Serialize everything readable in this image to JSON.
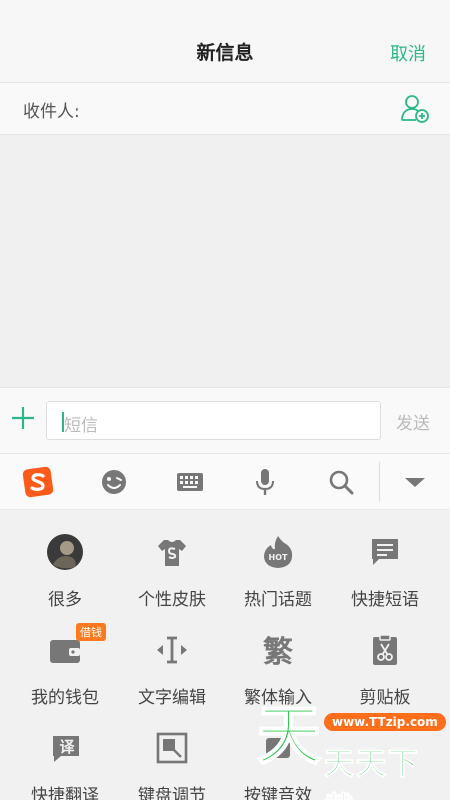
{
  "header": {
    "title": "新信息",
    "cancel_label": "取消"
  },
  "recipient": {
    "label": "收件人:"
  },
  "compose": {
    "placeholder": "短信",
    "send_label": "发送"
  },
  "ime_toolbar": {
    "icons": [
      "sogou-logo-icon",
      "emoji-icon",
      "keyboard-icon",
      "microphone-icon",
      "search-icon",
      "collapse-icon"
    ]
  },
  "panel": {
    "items": [
      {
        "label": "很多",
        "icon": "avatar-icon"
      },
      {
        "label": "个性皮肤",
        "icon": "tshirt-icon"
      },
      {
        "label": "热门话题",
        "icon": "hot-icon"
      },
      {
        "label": "快捷短语",
        "icon": "message-icon"
      },
      {
        "label": "我的钱包",
        "icon": "wallet-icon",
        "badge": "借钱"
      },
      {
        "label": "文字编辑",
        "icon": "text-cursor-icon"
      },
      {
        "label": "繁体输入",
        "icon": "traditional-icon",
        "glyph": "繁"
      },
      {
        "label": "剪贴板",
        "icon": "clipboard-icon"
      },
      {
        "label": "快捷翻译",
        "icon": "translate-icon",
        "glyph": "译"
      },
      {
        "label": "键盘调节",
        "icon": "resize-icon"
      },
      {
        "label": "按键音效",
        "icon": "sound-icon"
      }
    ]
  },
  "watermark": {
    "glyph": "天",
    "url": "www.TTzip.com",
    "brand": "天天下载"
  },
  "colors": {
    "accent": "#2bb78a",
    "sogou": "#ff5a1a",
    "icon_gray": "#777777"
  }
}
